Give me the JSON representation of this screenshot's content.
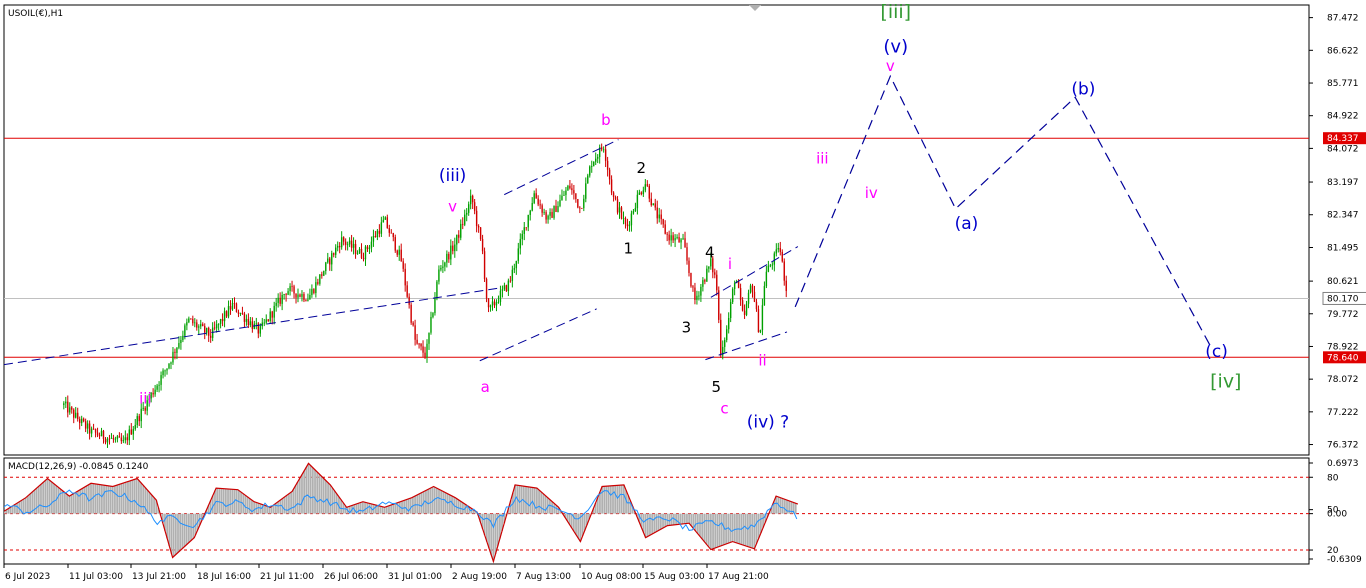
{
  "symbol_label": "USOIL(€),H1",
  "macd_label": "MACD(12,26,9) -0.0845 0.1240",
  "colors": {
    "bull_candle": "#00a000",
    "bear_candle": "#d00000",
    "horizontal_level": "#e00000",
    "channel": "#000099",
    "projection": "#000099",
    "macd_line": "#cc0000",
    "macd_signal": "#1e90ff",
    "macd_histogram": "#b0b0b0",
    "wave_blue": "#0000cc",
    "wave_magenta": "#ff00ff",
    "wave_black": "#000000",
    "wave_green": "#339933"
  },
  "chart_data": [
    {
      "type": "candlestick",
      "price_axis_ticks": [
        "87.472",
        "86.622",
        "85.771",
        "84.922",
        "84.072",
        "83.197",
        "82.347",
        "81.495",
        "80.621",
        "79.772",
        "78.922",
        "78.072",
        "77.222",
        "76.372"
      ],
      "time_axis_ticks": [
        "6 Jul 2023",
        "11 Jul 03:00",
        "13 Jul 21:00",
        "18 Jul 16:00",
        "21 Jul 11:00",
        "26 Jul 06:00",
        "31 Jul 01:00",
        "2 Aug 19:00",
        "7 Aug 13:00",
        "10 Aug 08:00",
        "15 Aug 03:00",
        "17 Aug 21:00"
      ],
      "ylim": [
        76.1,
        87.8
      ],
      "horizontal_levels": [
        {
          "value": 84.337,
          "label": "84.337"
        },
        {
          "value": 78.64,
          "label": "78.640"
        }
      ],
      "current_price": {
        "value": 80.17,
        "label": "80.170"
      },
      "close_path": [
        {
          "t": 0.11,
          "v": 77.4
        },
        {
          "t": 0.16,
          "v": 76.7
        },
        {
          "t": 0.22,
          "v": 76.4
        },
        {
          "t": 0.3,
          "v": 78.4
        },
        {
          "t": 0.34,
          "v": 79.6
        },
        {
          "t": 0.38,
          "v": 79.2
        },
        {
          "t": 0.42,
          "v": 80.0
        },
        {
          "t": 0.47,
          "v": 79.3
        },
        {
          "t": 0.52,
          "v": 80.4
        },
        {
          "t": 0.56,
          "v": 80.2
        },
        {
          "t": 0.62,
          "v": 81.7
        },
        {
          "t": 0.66,
          "v": 81.3
        },
        {
          "t": 0.7,
          "v": 82.2
        },
        {
          "t": 0.73,
          "v": 81.2
        },
        {
          "t": 0.757,
          "v": 79.0
        },
        {
          "t": 0.776,
          "v": 78.7
        },
        {
          "t": 0.8,
          "v": 80.9
        },
        {
          "t": 0.83,
          "v": 81.6
        },
        {
          "t": 0.86,
          "v": 82.8
        },
        {
          "t": 0.88,
          "v": 81.4
        },
        {
          "t": 0.89,
          "v": 79.8
        },
        {
          "t": 0.93,
          "v": 80.6
        },
        {
          "t": 0.975,
          "v": 82.9
        },
        {
          "t": 1.0,
          "v": 82.2
        },
        {
          "t": 1.04,
          "v": 83.1
        },
        {
          "t": 1.06,
          "v": 82.5
        },
        {
          "t": 1.08,
          "v": 83.7
        },
        {
          "t": 1.103,
          "v": 84.15
        },
        {
          "t": 1.12,
          "v": 82.8
        },
        {
          "t": 1.145,
          "v": 82.0
        },
        {
          "t": 1.165,
          "v": 82.8
        },
        {
          "t": 1.18,
          "v": 83.2
        },
        {
          "t": 1.195,
          "v": 82.5
        },
        {
          "t": 1.22,
          "v": 81.8
        },
        {
          "t": 1.25,
          "v": 81.6
        },
        {
          "t": 1.27,
          "v": 80.1
        },
        {
          "t": 1.3,
          "v": 81.1
        },
        {
          "t": 1.31,
          "v": 80.6
        },
        {
          "t": 1.318,
          "v": 78.8
        },
        {
          "t": 1.33,
          "v": 79.4
        },
        {
          "t": 1.345,
          "v": 80.8
        },
        {
          "t": 1.36,
          "v": 79.6
        },
        {
          "t": 1.375,
          "v": 80.6
        },
        {
          "t": 1.39,
          "v": 79.2
        },
        {
          "t": 1.4,
          "v": 80.8
        },
        {
          "t": 1.42,
          "v": 81.3
        },
        {
          "t": 1.425,
          "v": 81.6
        },
        {
          "t": 1.44,
          "v": 80.3
        }
      ],
      "channels": [
        {
          "p1": {
            "t": 0.0,
            "v": 78.45
          },
          "p2": {
            "t": 0.915,
            "v": 80.45
          }
        },
        {
          "p1": {
            "t": 0.875,
            "v": 78.55
          },
          "p2": {
            "t": 1.09,
            "v": 79.9
          }
        },
        {
          "p1": {
            "t": 0.92,
            "v": 82.87
          },
          "p2": {
            "t": 1.13,
            "v": 84.3
          }
        },
        {
          "p1": {
            "t": 1.3,
            "v": 80.2
          },
          "p2": {
            "t": 1.46,
            "v": 81.52
          }
        },
        {
          "p1": {
            "t": 1.29,
            "v": 78.58
          },
          "p2": {
            "t": 1.44,
            "v": 79.3
          }
        }
      ],
      "projection_path": [
        {
          "t": 1.455,
          "v": 79.95
        },
        {
          "t": 1.63,
          "v": 85.95
        },
        {
          "t": 1.75,
          "v": 82.5
        },
        {
          "t": 1.97,
          "v": 85.4
        },
        {
          "t": 2.22,
          "v": 78.9
        }
      ],
      "wave_labels": [
        {
          "text": "[iii]",
          "t": 1.64,
          "v": 87.6,
          "color": "green",
          "size": 19
        },
        {
          "text": "(v)",
          "t": 1.64,
          "v": 86.7,
          "color": "blue",
          "size": 18
        },
        {
          "text": "v",
          "t": 1.63,
          "v": 86.2,
          "color": "magenta",
          "size": 15
        },
        {
          "text": "(b)",
          "t": 1.985,
          "v": 85.6,
          "color": "blue",
          "size": 17
        },
        {
          "text": "b",
          "t": 1.107,
          "v": 84.8,
          "color": "magenta",
          "size": 15
        },
        {
          "text": "iii",
          "t": 1.505,
          "v": 83.8,
          "color": "magenta",
          "size": 15
        },
        {
          "text": "2",
          "t": 1.172,
          "v": 83.55,
          "color": "black",
          "size": 15
        },
        {
          "text": "(iii)",
          "t": 0.825,
          "v": 83.35,
          "color": "blue",
          "size": 17
        },
        {
          "text": "iv",
          "t": 1.595,
          "v": 82.9,
          "color": "magenta",
          "size": 15
        },
        {
          "text": "v",
          "t": 0.825,
          "v": 82.55,
          "color": "magenta",
          "size": 15
        },
        {
          "text": "(a)",
          "t": 1.77,
          "v": 82.1,
          "color": "blue",
          "size": 17
        },
        {
          "text": "1",
          "t": 1.148,
          "v": 81.45,
          "color": "black",
          "size": 15
        },
        {
          "text": "4",
          "t": 1.298,
          "v": 81.35,
          "color": "black",
          "size": 15
        },
        {
          "text": "i",
          "t": 1.335,
          "v": 81.05,
          "color": "magenta",
          "size": 15
        },
        {
          "text": "3",
          "t": 1.255,
          "v": 79.4,
          "color": "black",
          "size": 15
        },
        {
          "text": "(c)",
          "t": 2.23,
          "v": 78.78,
          "color": "blue",
          "size": 17
        },
        {
          "text": "ii",
          "t": 1.395,
          "v": 78.55,
          "color": "magenta",
          "size": 15
        },
        {
          "text": "a",
          "t": 0.885,
          "v": 77.85,
          "color": "magenta",
          "size": 15
        },
        {
          "text": "[iv]",
          "t": 2.247,
          "v": 78.0,
          "color": "green",
          "size": 19
        },
        {
          "text": "5",
          "t": 1.31,
          "v": 77.85,
          "color": "black",
          "size": 15
        },
        {
          "text": "iii",
          "t": 0.26,
          "v": 77.55,
          "color": "magenta",
          "size": 15
        },
        {
          "text": "c",
          "t": 1.325,
          "v": 77.3,
          "color": "magenta",
          "size": 15
        },
        {
          "text": "(iv) ?",
          "t": 1.405,
          "v": 76.95,
          "color": "blue",
          "size": 17
        }
      ]
    },
    {
      "type": "macd",
      "ylim": [
        -0.6309,
        0.6973
      ],
      "axis_ticks": [
        "0.6973",
        "80",
        "0.00",
        "50",
        "20",
        "-0.6309"
      ],
      "levels": [
        {
          "value": 0.456,
          "style": "dashed"
        },
        {
          "value": 0.0,
          "style": "dashed"
        },
        {
          "value": -0.456,
          "style": "dashed"
        }
      ],
      "macd_path": [
        {
          "t": 0.0,
          "v": 0.03
        },
        {
          "t": 0.04,
          "v": 0.2
        },
        {
          "t": 0.08,
          "v": 0.44
        },
        {
          "t": 0.12,
          "v": 0.22
        },
        {
          "t": 0.16,
          "v": 0.38
        },
        {
          "t": 0.2,
          "v": 0.34
        },
        {
          "t": 0.245,
          "v": 0.44
        },
        {
          "t": 0.28,
          "v": 0.17
        },
        {
          "t": 0.31,
          "v": -0.55
        },
        {
          "t": 0.35,
          "v": -0.3
        },
        {
          "t": 0.39,
          "v": 0.32
        },
        {
          "t": 0.43,
          "v": 0.3
        },
        {
          "t": 0.46,
          "v": 0.15
        },
        {
          "t": 0.49,
          "v": 0.08
        },
        {
          "t": 0.53,
          "v": 0.28
        },
        {
          "t": 0.56,
          "v": 0.63
        },
        {
          "t": 0.6,
          "v": 0.36
        },
        {
          "t": 0.63,
          "v": 0.08
        },
        {
          "t": 0.66,
          "v": 0.15
        },
        {
          "t": 0.7,
          "v": 0.08
        },
        {
          "t": 0.75,
          "v": 0.2
        },
        {
          "t": 0.79,
          "v": 0.34
        },
        {
          "t": 0.83,
          "v": 0.2
        },
        {
          "t": 0.87,
          "v": 0.02
        },
        {
          "t": 0.9,
          "v": -0.6
        },
        {
          "t": 0.94,
          "v": 0.36
        },
        {
          "t": 0.98,
          "v": 0.32
        },
        {
          "t": 1.02,
          "v": 0.08
        },
        {
          "t": 1.06,
          "v": -0.35
        },
        {
          "t": 1.1,
          "v": 0.34
        },
        {
          "t": 1.14,
          "v": 0.36
        },
        {
          "t": 1.18,
          "v": -0.3
        },
        {
          "t": 1.22,
          "v": -0.15
        },
        {
          "t": 1.26,
          "v": -0.12
        },
        {
          "t": 1.3,
          "v": -0.45
        },
        {
          "t": 1.34,
          "v": -0.35
        },
        {
          "t": 1.38,
          "v": -0.44
        },
        {
          "t": 1.42,
          "v": 0.22
        },
        {
          "t": 1.46,
          "v": 0.12
        }
      ],
      "signal_path": [
        {
          "t": 0.0,
          "v": 0.12
        },
        {
          "t": 0.04,
          "v": 0.02
        },
        {
          "t": 0.08,
          "v": 0.1
        },
        {
          "t": 0.12,
          "v": 0.3
        },
        {
          "t": 0.16,
          "v": 0.18
        },
        {
          "t": 0.2,
          "v": 0.28
        },
        {
          "t": 0.245,
          "v": 0.15
        },
        {
          "t": 0.28,
          "v": -0.1
        },
        {
          "t": 0.31,
          "v": -0.05
        },
        {
          "t": 0.35,
          "v": -0.15
        },
        {
          "t": 0.39,
          "v": 0.12
        },
        {
          "t": 0.43,
          "v": 0.14
        },
        {
          "t": 0.46,
          "v": 0.05
        },
        {
          "t": 0.49,
          "v": 0.12
        },
        {
          "t": 0.53,
          "v": 0.06
        },
        {
          "t": 0.56,
          "v": 0.22
        },
        {
          "t": 0.6,
          "v": 0.14
        },
        {
          "t": 0.63,
          "v": 0.05
        },
        {
          "t": 0.66,
          "v": 0.02
        },
        {
          "t": 0.7,
          "v": 0.14
        },
        {
          "t": 0.75,
          "v": 0.06
        },
        {
          "t": 0.79,
          "v": 0.18
        },
        {
          "t": 0.83,
          "v": 0.12
        },
        {
          "t": 0.87,
          "v": 0.04
        },
        {
          "t": 0.9,
          "v": -0.15
        },
        {
          "t": 0.94,
          "v": 0.2
        },
        {
          "t": 0.98,
          "v": 0.1
        },
        {
          "t": 1.02,
          "v": 0.05
        },
        {
          "t": 1.06,
          "v": -0.05
        },
        {
          "t": 1.1,
          "v": 0.3
        },
        {
          "t": 1.14,
          "v": 0.2
        },
        {
          "t": 1.18,
          "v": -0.1
        },
        {
          "t": 1.22,
          "v": -0.05
        },
        {
          "t": 1.26,
          "v": -0.2
        },
        {
          "t": 1.3,
          "v": -0.1
        },
        {
          "t": 1.34,
          "v": -0.2
        },
        {
          "t": 1.38,
          "v": -0.15
        },
        {
          "t": 1.42,
          "v": 0.15
        },
        {
          "t": 1.46,
          "v": -0.05
        }
      ]
    }
  ]
}
